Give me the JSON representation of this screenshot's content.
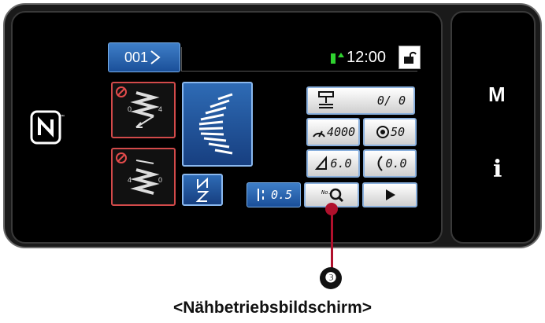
{
  "header": {
    "pattern_number": "001",
    "clock": "12:00"
  },
  "counters": {
    "bobbin_counter": "0/ 0",
    "speed": "4000",
    "stitch_count": "50",
    "stitch_length": "6.0",
    "condensation_length": "0.0",
    "reverse_value": "0.5"
  },
  "side": {
    "mode_label": "M",
    "info_label": "i"
  },
  "callout": {
    "number": "❸"
  },
  "caption": "<Nähbetriebsbildschirm>",
  "colors": {
    "accent_blue": "#2e6bb5",
    "alert_red": "#d24a4a",
    "status_green": "#2fd12f",
    "callout_red": "#b0102c"
  }
}
